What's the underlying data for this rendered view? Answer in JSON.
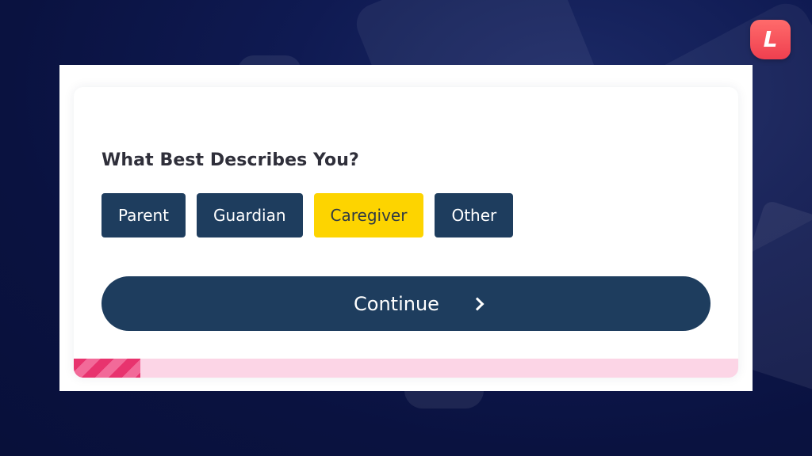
{
  "logo": {
    "letter": "L"
  },
  "form": {
    "question": "What Best Describes You?",
    "options": [
      {
        "label": "Parent",
        "selected": false
      },
      {
        "label": "Guardian",
        "selected": false
      },
      {
        "label": "Caregiver",
        "selected": true
      },
      {
        "label": "Other",
        "selected": false
      }
    ],
    "continue_label": "Continue"
  },
  "progress": {
    "fraction": 0.1
  },
  "colors": {
    "option_bg": "#1e3d5e",
    "selected_bg": "#fdd400",
    "progress_fill": "#e8336e",
    "progress_track": "#fcd5e6",
    "logo": "#ef3f4f"
  },
  "icons": {
    "continue": "chevron-right-icon",
    "logo": "brand-logo-icon"
  }
}
